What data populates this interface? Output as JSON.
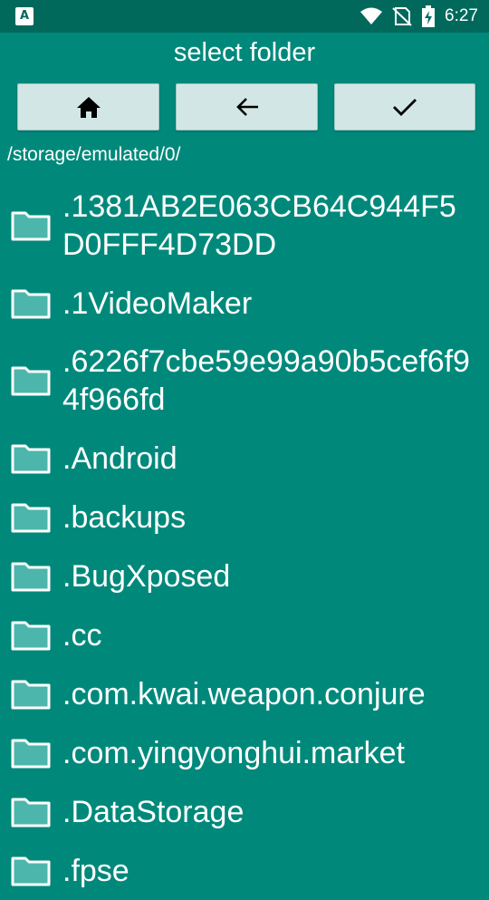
{
  "status_bar": {
    "app_icon_letter": "A",
    "time": "6:27",
    "icons": [
      "wifi-icon",
      "no-sim-icon",
      "battery-charging-icon"
    ]
  },
  "dialog": {
    "title": "select folder",
    "buttons": [
      {
        "icon": "home-icon"
      },
      {
        "icon": "arrow-back-icon"
      },
      {
        "icon": "check-icon"
      }
    ],
    "current_path": "/storage/emulated/0/",
    "folders": [
      ".1381AB2E063CB64C944F5D0FFF4D73DD",
      ".1VideoMaker",
      ".6226f7cbe59e99a90b5cef6f94f966fd",
      ".Android",
      ".backups",
      ".BugXposed",
      ".cc",
      ".com.kwai.weapon.conjure",
      ".com.yingyonghui.market",
      ".DataStorage",
      ".fpse"
    ]
  },
  "colors": {
    "background": "#00897b",
    "status_bar": "#00695c",
    "button_bg": "#d2e7e5",
    "folder_icon": "#ffffff",
    "folder_fill": "#4db6ac"
  }
}
